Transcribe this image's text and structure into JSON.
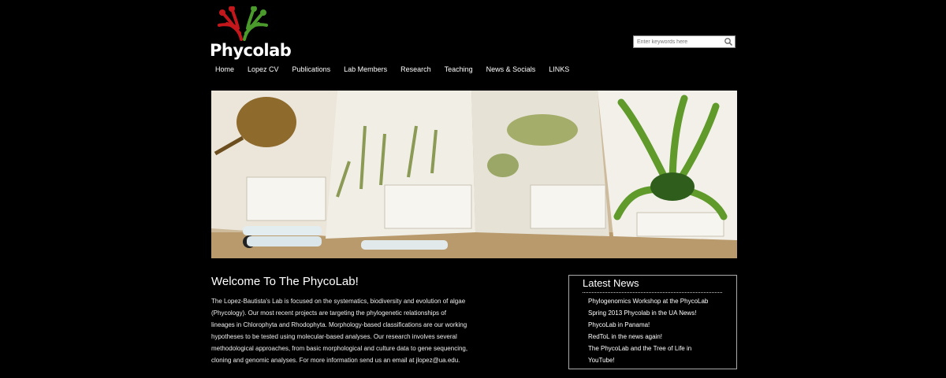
{
  "brand": {
    "logo_text": "Phycolab",
    "colors": {
      "logo_red": "#c3171c",
      "logo_green": "#4a9a2c"
    }
  },
  "search": {
    "placeholder": "Enter keywords here",
    "icon": "search-icon"
  },
  "nav": {
    "items": [
      "Home",
      "Lopez CV",
      "Publications",
      "Lab Members",
      "Research",
      "Teaching",
      "News & Socials",
      "LINKS"
    ]
  },
  "welcome": {
    "title": "Welcome To The PhycoLab!",
    "lines": [
      "The Lopez-Bautista's Lab is focused on the systematics, biodiversity and evolution of algae",
      "(Phycology). Our most recent projects are targeting the phylogenetic relationships of",
      "lineages in Chlorophyta and Rhodophyta. Morphology-based classifications are our working",
      "hypotheses to be tested using molecular-based analyses. Our research involves several",
      "methodological approaches, from basic morphological and culture data to gene sequencing,",
      "cloning and genomic analyses. For more information send us an email at jlopez@ua.edu."
    ]
  },
  "news": {
    "title": "Latest News",
    "items": [
      "Phylogenomics Workshop at the PhycoLab",
      "Spring 2013 Phycolab in the UA News!",
      "PhycoLab in Panama!",
      "RedToL in the news again!",
      "The PhycoLab and the Tree of Life in",
      "YouTube!"
    ]
  }
}
